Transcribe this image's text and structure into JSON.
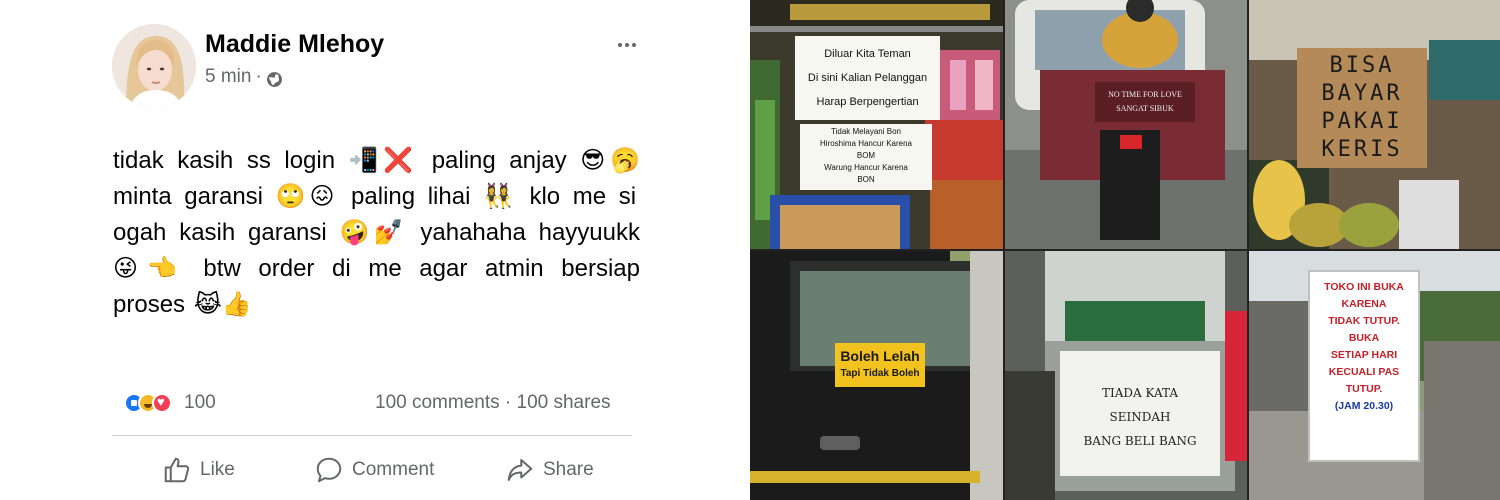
{
  "post": {
    "author": "Maddie Mlehoy",
    "time": "5 min",
    "separator": "·",
    "privacy_icon": "globe-icon",
    "menu_icon": "more-horizontal-icon",
    "text": "tidak kasih ss login 📲❌ paling anjay 😎🥱 minta garansi 🙄😖 paling lihai 👯‍♀️ klo me si ogah kasih garansi 🤪💅 yahahaha hayyuukk 😜👈 btw order di me agar atmin bersiap proses 😹👍",
    "reactions": {
      "icons": [
        "like-reaction-icon",
        "haha-reaction-icon",
        "love-reaction-icon"
      ],
      "count": "100"
    },
    "comments_label": "100 comments",
    "stats_separator": "·",
    "shares_label": "100 shares",
    "actions": {
      "like": "Like",
      "comment": "Comment",
      "share": "Share"
    }
  },
  "collage": {
    "photo1": {
      "lines_top": [
        "Diluar Kita Teman",
        "Di sini Kalian Pelanggan",
        "Harap Berpengertian"
      ],
      "lines_bottom": [
        "Tidak Melayani Bon",
        "Hiroshima Hancur Karena",
        "BOM",
        "Warung Hancur Karena",
        "BON"
      ]
    },
    "photo2": {
      "lines": [
        "NO TIME FOR LOVE",
        "SANGAT SIBUK"
      ]
    },
    "photo3": {
      "lines": [
        "BISA",
        "BAYAR",
        "PAKAI",
        "KERIS"
      ]
    },
    "photo4": {
      "line1": "Boleh Lelah",
      "line2": "Tapi Tidak Boleh"
    },
    "photo5": {
      "lines": [
        "TIADA KATA",
        "SEINDAH",
        "BANG BELI BANG"
      ]
    },
    "photo6": {
      "lines": [
        "TOKO INI BUKA",
        "KARENA",
        "TIDAK TUTUP.",
        "BUKA",
        "SETIAP HARI",
        "KECUALI PAS",
        "TUTUP."
      ],
      "hours": "(JAM 20.30)"
    }
  },
  "colors": {
    "text_primary": "#050505",
    "text_secondary": "#65676b",
    "like_blue": "#1877f2",
    "divider": "#ced0d4"
  }
}
